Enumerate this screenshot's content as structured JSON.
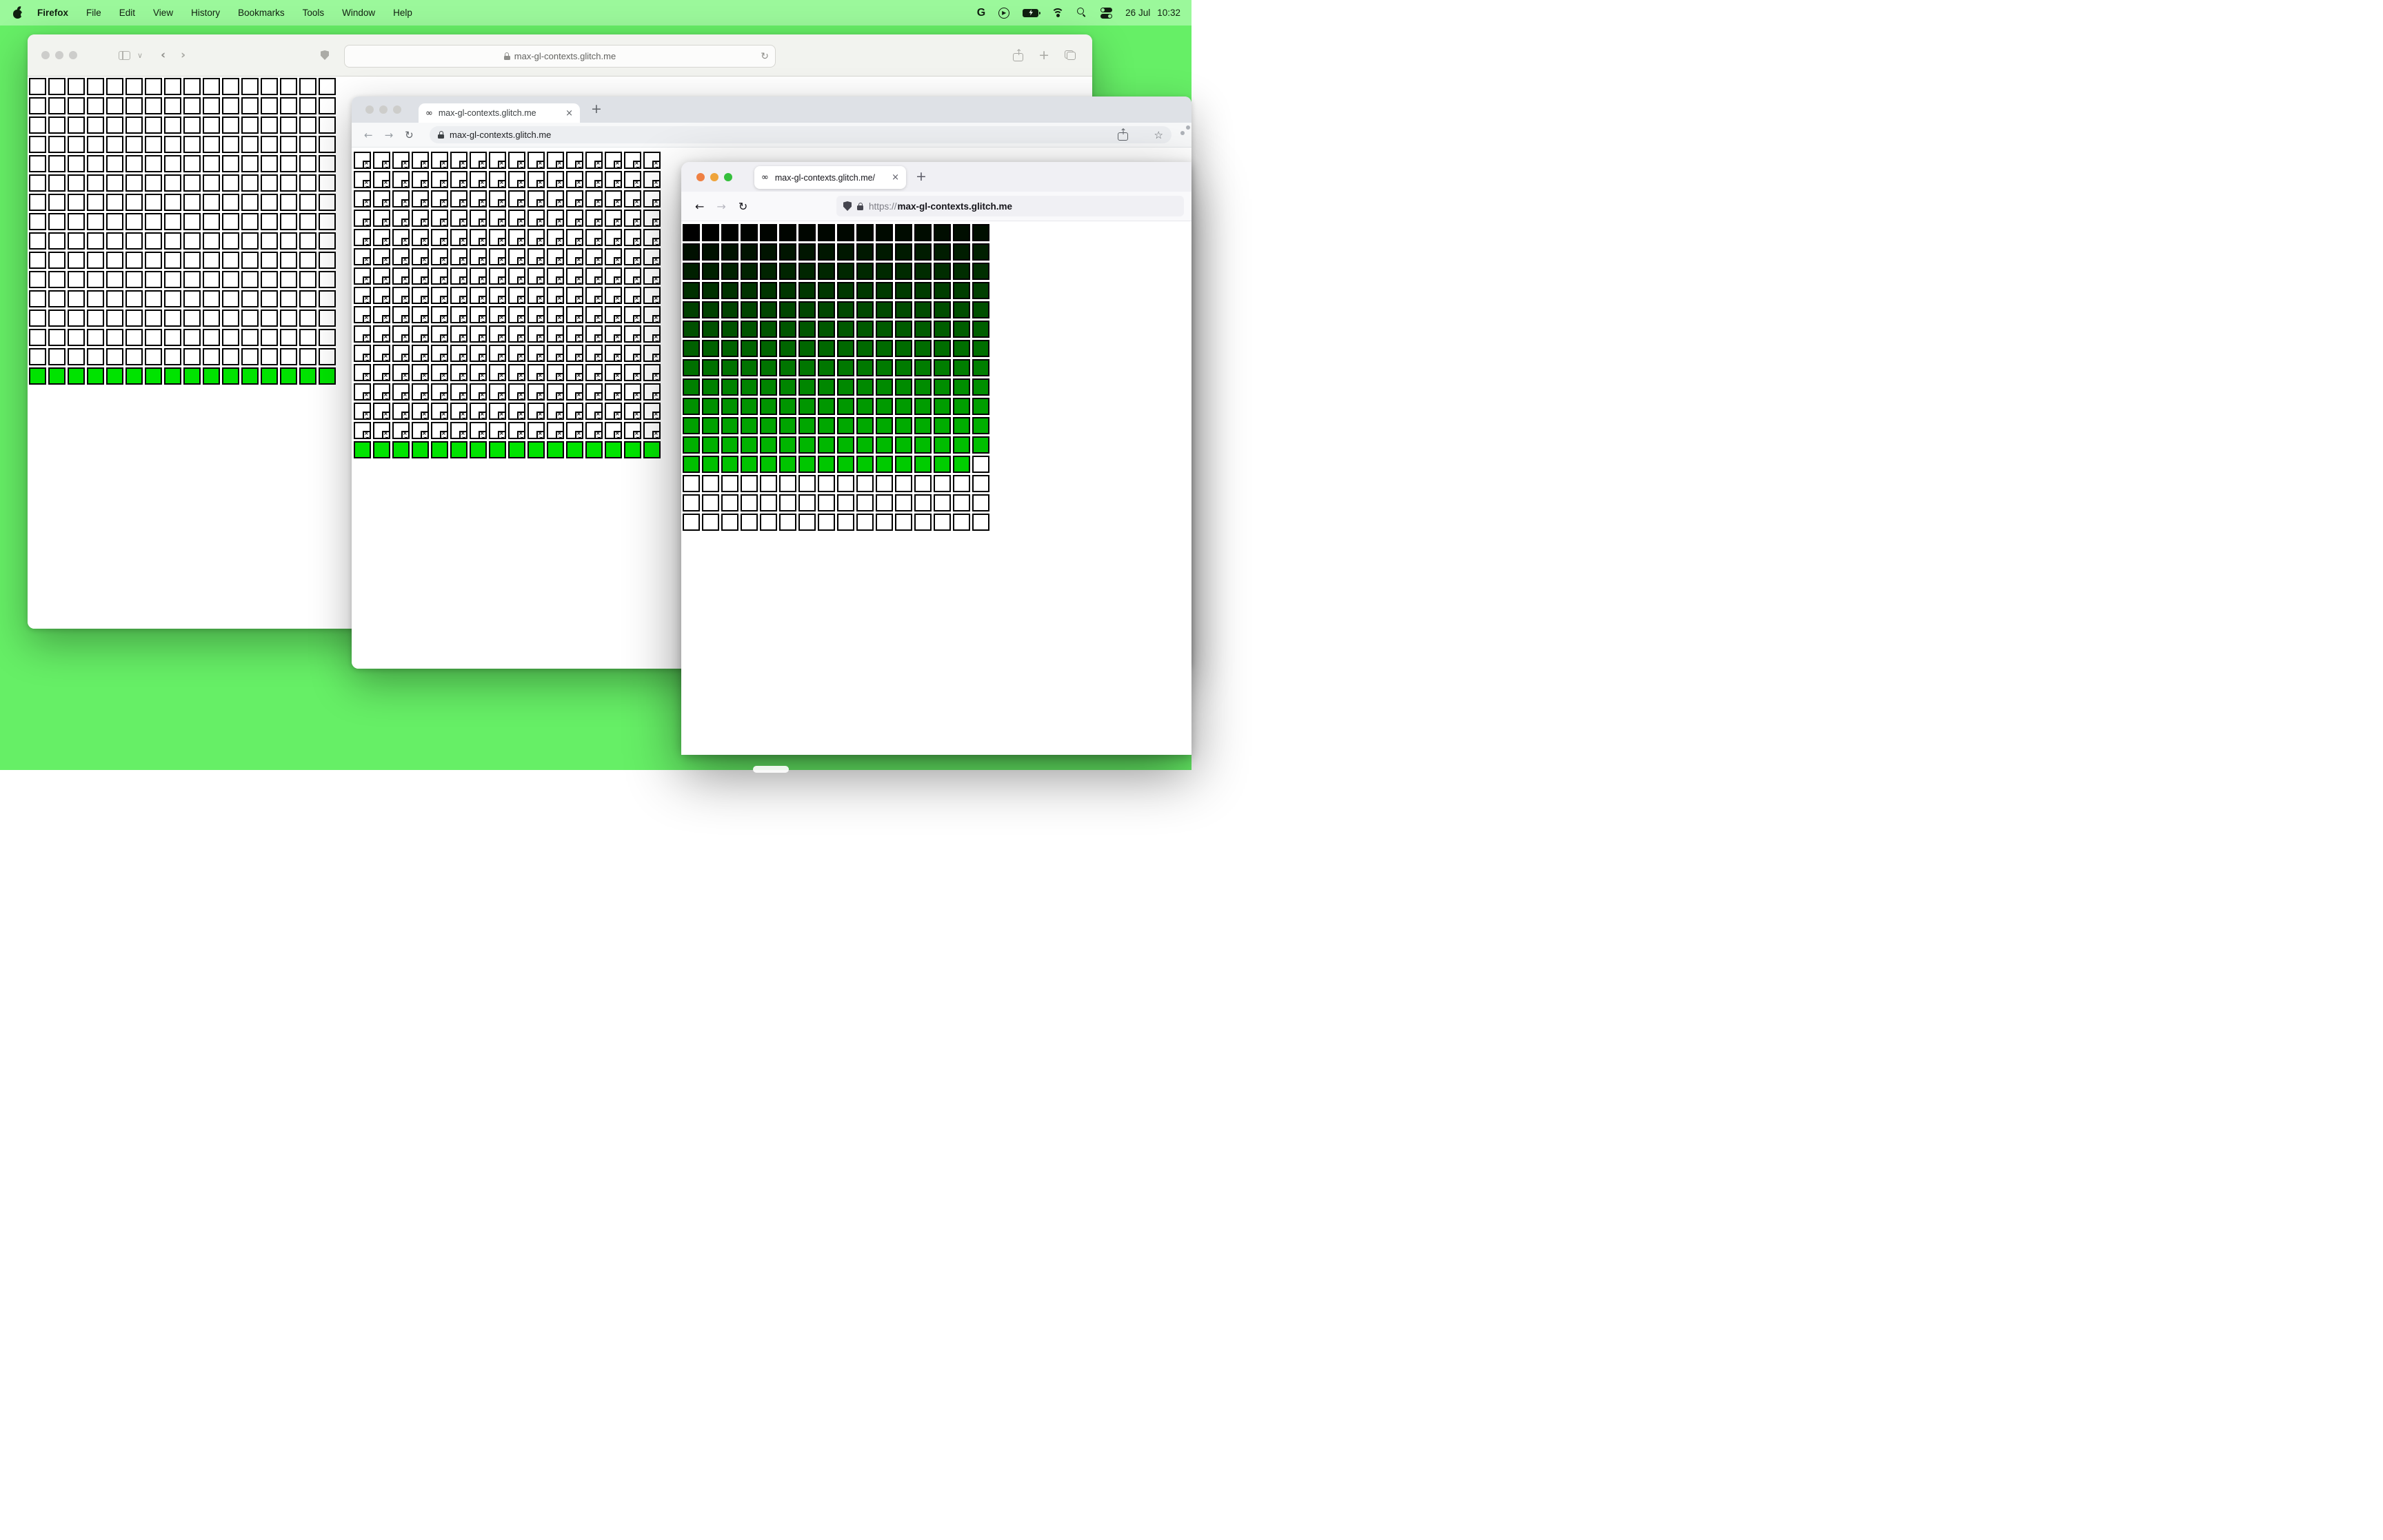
{
  "colors": {
    "desktop": "#66ef66",
    "menubar": "#9bf89b",
    "cell_green": "#00e300",
    "traffic_inactive": "#cdcdcb",
    "ff_close": "#ef8043",
    "ff_min": "#efa43b",
    "ff_zoom": "#35bf3c"
  },
  "menubar": {
    "app_name": "Firefox",
    "menus": [
      "File",
      "Edit",
      "View",
      "History",
      "Bookmarks",
      "Tools",
      "Window",
      "Help"
    ],
    "status_date": "26 Jul",
    "status_time": "10:32"
  },
  "safari_window": {
    "url": "max-gl-contexts.glitch.me"
  },
  "chrome_window": {
    "tab_title": "max-gl-contexts.glitch.me",
    "tab_favicon": "∞",
    "tab_close": "×",
    "new_tab": "+",
    "back": "←",
    "forward": "→",
    "reload": "↻",
    "url": "max-gl-contexts.glitch.me",
    "bookmark_star": "☆"
  },
  "firefox_window": {
    "tab_title": "max-gl-contexts.glitch.me/",
    "tab_favicon": "∞",
    "tab_close": "×",
    "new_tab": "+",
    "back": "←",
    "forward": "→",
    "reload": "↻",
    "url_scheme": "https://",
    "url_host": "max-gl-contexts.glitch.me"
  },
  "safari_toolbar": {
    "chevron_down": "∨",
    "back": "‹",
    "forward": "›",
    "reload": "↻",
    "plus": "+",
    "share_arrow": "↑"
  },
  "grids": {
    "safari": {
      "cols": 16,
      "rows": 16,
      "pattern": "blank",
      "bottom_row_color": "#00e300"
    },
    "chrome": {
      "cols": 16,
      "rows": 16,
      "pattern": "broken",
      "bottom_row_color": "#00e300",
      "broken_glyph": "×"
    },
    "firefox": {
      "cols": 16,
      "rows": 16,
      "pattern": "gradient",
      "colored_cells": 207,
      "color_rule": "rgb(0,index,0)"
    }
  },
  "status_icons": {
    "google_g": "G",
    "play": "▶"
  }
}
